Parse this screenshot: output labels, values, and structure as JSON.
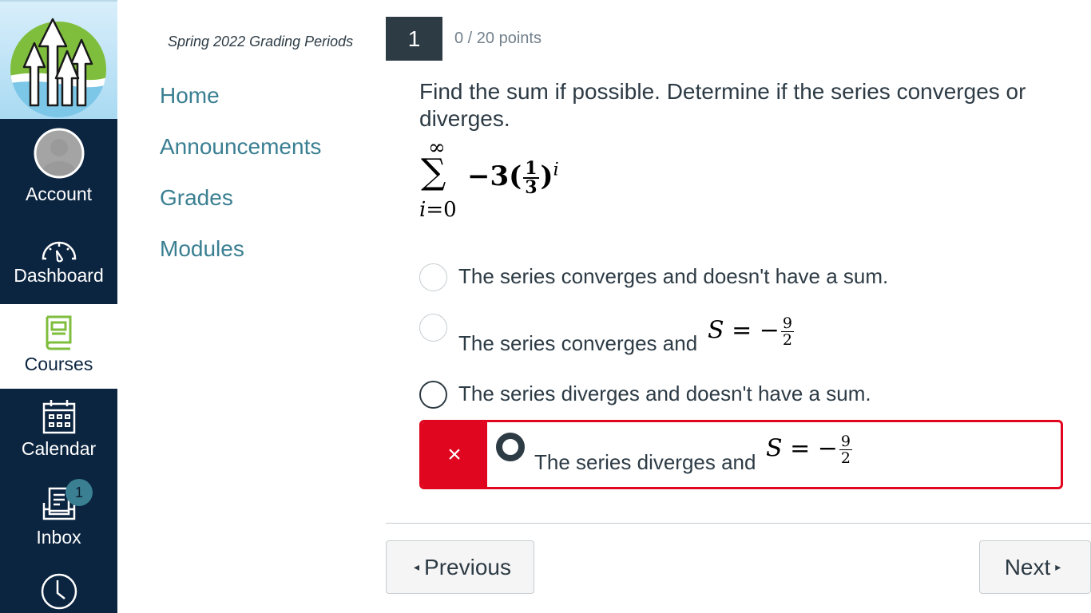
{
  "global_nav": {
    "logo": "school-logo-trees-arrows",
    "items": [
      {
        "label": "Account",
        "icon": "avatar-icon",
        "active": false
      },
      {
        "label": "Dashboard",
        "icon": "speedometer-icon",
        "active": false
      },
      {
        "label": "Courses",
        "icon": "book-icon",
        "active": true
      },
      {
        "label": "Calendar",
        "icon": "calendar-icon",
        "active": false
      },
      {
        "label": "Inbox",
        "icon": "inbox-icon",
        "active": false,
        "badge": "1"
      },
      {
        "label": "",
        "icon": "clock-icon",
        "active": false
      }
    ],
    "colors": {
      "background": "#0b2440",
      "active_icon": "#7fbe3c",
      "badge": "#3a7f92"
    }
  },
  "course_nav": {
    "grading_periods": "Spring 2022 Grading Periods",
    "links": [
      "Home",
      "Announcements",
      "Grades",
      "Modules"
    ],
    "link_color": "#3a7f92"
  },
  "question": {
    "number": "1",
    "points": "0 / 20 points",
    "text": "Find the sum if possible. Determine if the series converges or diverges.",
    "series": {
      "upper": "∞",
      "sigma": "∑",
      "lower_var": "i",
      "lower_eq": "=0",
      "coefficient": "−3(",
      "frac_num": "1",
      "frac_den": "3",
      "close": ")",
      "exponent": "i"
    },
    "answers": [
      {
        "text": "The series converges and doesn't have a sum.",
        "math": null,
        "selected": false
      },
      {
        "text": "The series converges and",
        "math": {
          "lhs": "S",
          "eq": " = −",
          "num": "9",
          "den": "2"
        },
        "selected": false
      },
      {
        "text": "The series diverges and doesn't have a sum.",
        "math": null,
        "selected": false
      },
      {
        "text": "The series diverges and",
        "math": {
          "lhs": "S",
          "eq": " = −",
          "num": "9",
          "den": "2"
        },
        "selected": true,
        "incorrect": true
      }
    ],
    "incorrect_mark": "×",
    "incorrect_color": "#e0061f"
  },
  "footer": {
    "previous_label": "Previous",
    "previous_icon": "◂",
    "next_label": "Next",
    "next_icon": "▸"
  }
}
